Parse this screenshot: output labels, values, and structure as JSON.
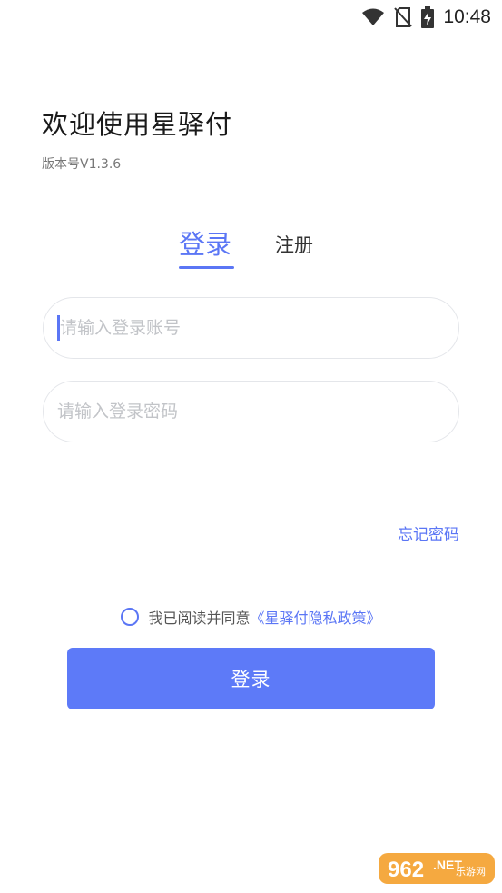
{
  "status_bar": {
    "time": "10:48",
    "icons": [
      "wifi-icon",
      "no-sim-icon",
      "battery-charging-icon"
    ]
  },
  "header": {
    "title": "欢迎使用星驿付",
    "version": "版本号V1.3.6"
  },
  "tabs": [
    {
      "label": "登录",
      "active": true
    },
    {
      "label": "注册",
      "active": false
    }
  ],
  "form": {
    "account_placeholder": "请输入登录账号",
    "account_value": "",
    "password_placeholder": "请输入登录密码",
    "password_value": "",
    "forgot_label": "忘记密码"
  },
  "agreement": {
    "checked": false,
    "text": "我已阅读并同意",
    "policy_link": "《星驿付隐私政策》"
  },
  "submit": {
    "label": "登录"
  },
  "watermark": {
    "brand": "962.NET",
    "sub": "乐游网"
  },
  "colors": {
    "accent": "#5b76f5",
    "button": "#5d7af8",
    "border": "#e4e6ea",
    "placeholder": "#c2c4c8",
    "watermark_orange": "#f39a1e"
  }
}
